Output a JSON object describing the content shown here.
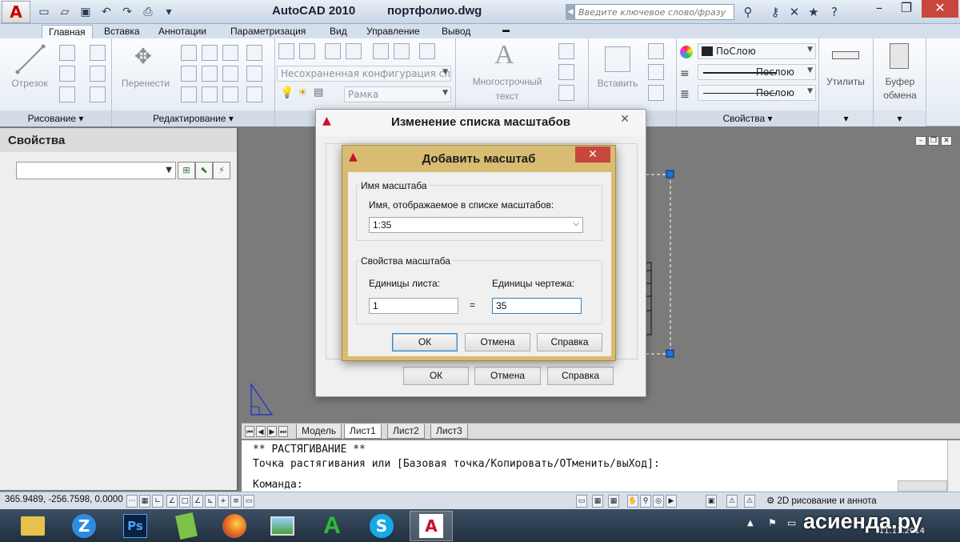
{
  "titlebar": {
    "app_logo": "A",
    "app_title": "AutoCAD 2010",
    "doc_title": "портфолио.dwg",
    "search_placeholder": "Введите ключевое слово/фразу"
  },
  "ribbon_tabs": [
    "Главная",
    "Вставка",
    "Аннотации",
    "Параметризация",
    "Вид",
    "Управление",
    "Вывод"
  ],
  "ribbon": {
    "draw": {
      "title": "Рисование",
      "line_label": "Отрезок"
    },
    "modify": {
      "title": "Редактирование",
      "move_label": "Перенести"
    },
    "layers": {
      "state_combo": "Несохраненная конфигурация сл",
      "layer_combo": "Рамка"
    },
    "annotation": {
      "text_label_1": "Многострочный",
      "text_label_2": "текст"
    },
    "block": {
      "insert_label": "Вставить"
    },
    "properties": {
      "title": "Свойства",
      "color_combo": "ПоСлою",
      "linetype_combo": "Послою",
      "lineweight_combo": "Послою"
    },
    "utilities": {
      "label": "Утилиты"
    },
    "clipboard": {
      "label_1": "Буфер",
      "label_2": "обмена"
    }
  },
  "properties_palette": {
    "title": "Свойства"
  },
  "layout_tabs": [
    "Модель",
    "Лист1",
    "Лист2",
    "Лист3"
  ],
  "command": {
    "line1": "** РАСТЯГИВАНИЕ **",
    "line2": "Точка растягивания или [Базовая точка/Копировать/ОТменить/выХод]:",
    "prompt": "Команда:"
  },
  "statusbar": {
    "coords": "365.9489, -256.7598, 0.0000",
    "workspace": "2D рисование и аннота"
  },
  "dialog_scale_list": {
    "title": "Изменение списка масштабов",
    "ok": "ОК",
    "cancel": "Отмена",
    "help": "Справка"
  },
  "dialog_add_scale": {
    "title": "Добавить масштаб",
    "name_group": "Имя масштаба",
    "name_label": "Имя, отображаемое в списке масштабов:",
    "name_value": "1:35",
    "props_group": "Свойства масштаба",
    "paper_units_label": "Единицы листа:",
    "drawing_units_label": "Единицы чертежа:",
    "paper_units_value": "1",
    "equals": "=",
    "drawing_units_value": "35",
    "ok": "ОК",
    "cancel": "Отмена",
    "help": "Справка"
  },
  "taskbar": {
    "date": "11.11.2014",
    "watermark": "асиенда.ру"
  },
  "colors": {
    "accent_dialog_frame": "#d7bc72",
    "close_button": "#c9463d",
    "grip_blue": "#1f6fe0",
    "model_background": "#7b7b7b"
  }
}
